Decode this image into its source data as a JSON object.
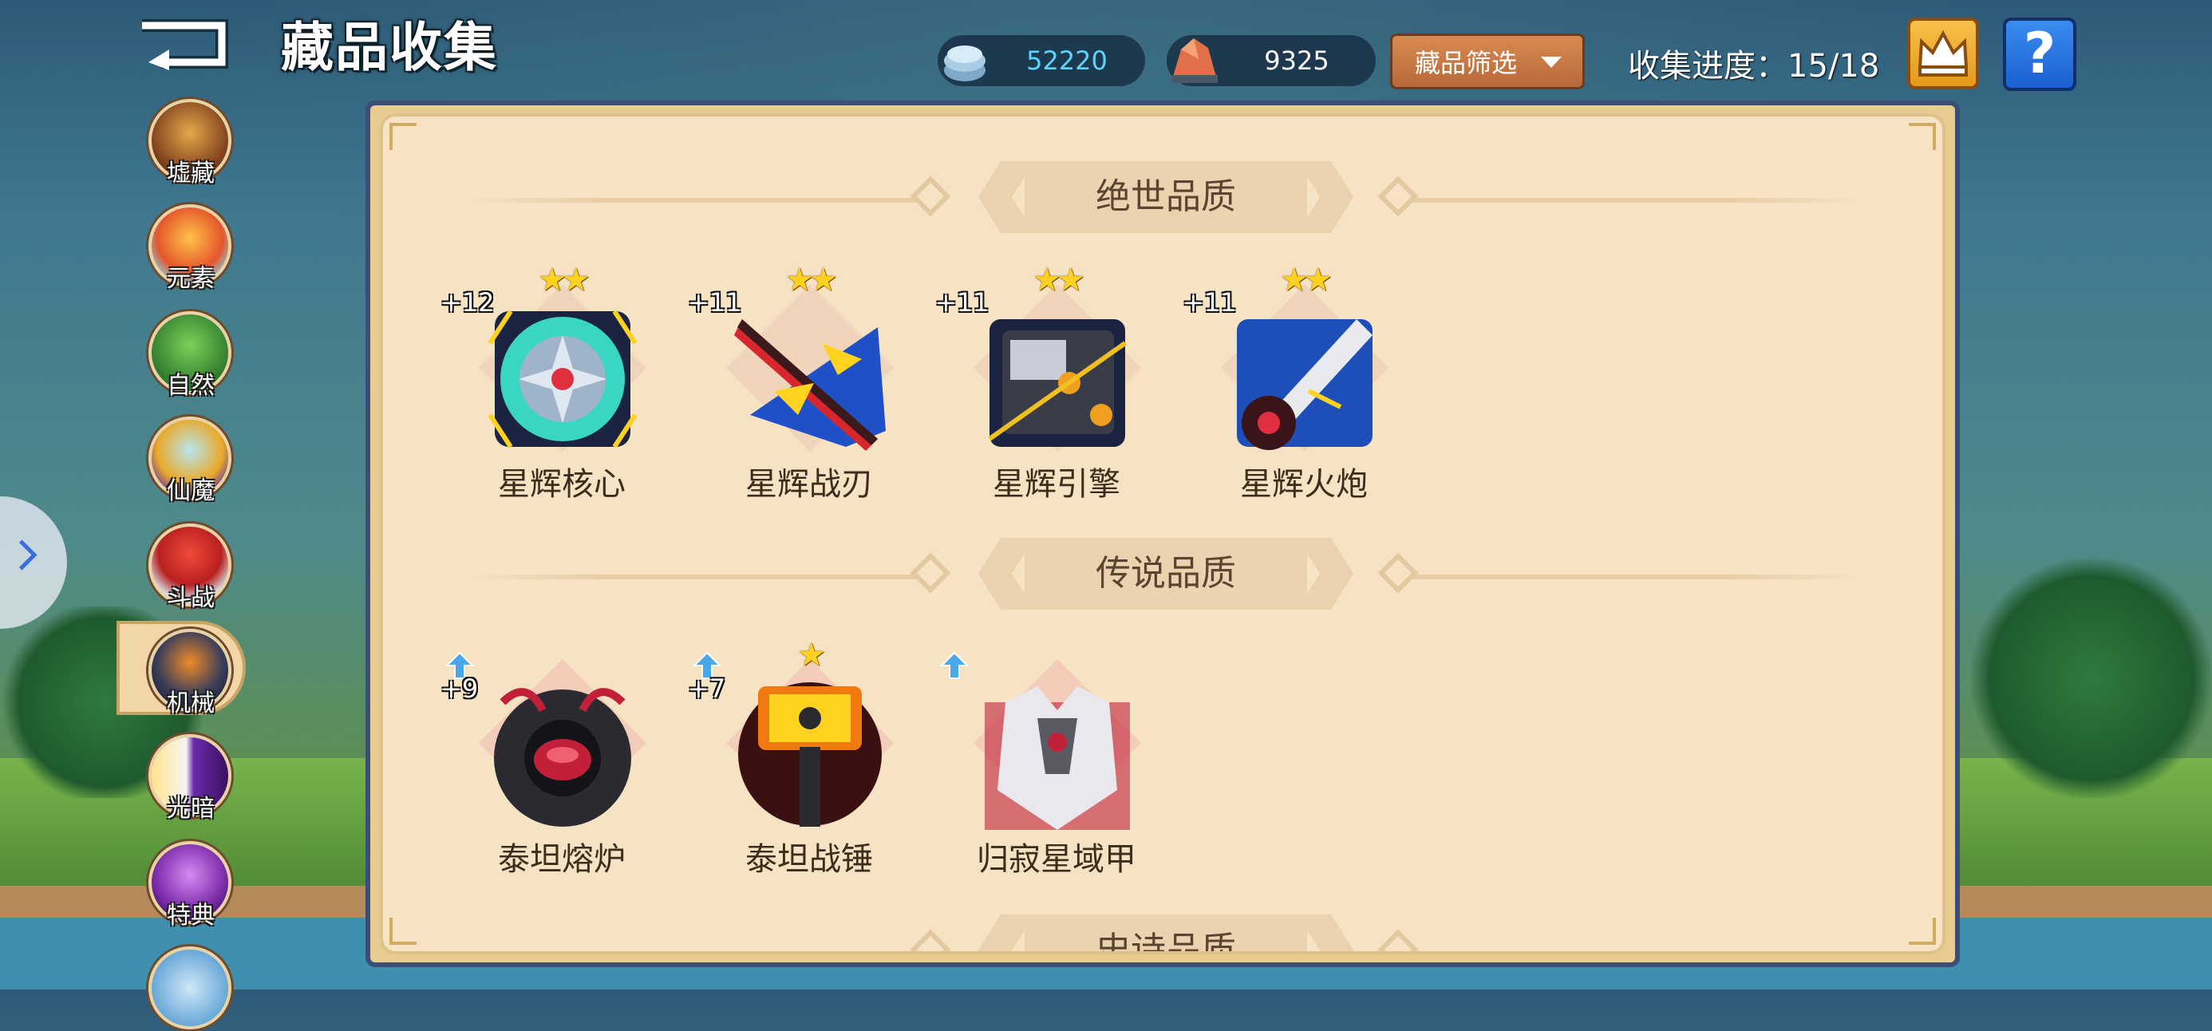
{
  "header": {
    "title": "藏品收集",
    "back_icon": "back-arrow-icon",
    "resources": [
      {
        "icon": "crystal-coin-icon",
        "value": "52220",
        "color": "#5fd3ff"
      },
      {
        "icon": "ore-icon",
        "value": "9325",
        "color": "#ffffff"
      }
    ],
    "filter_label": "藏品筛选",
    "progress_text": "收集进度：15/18",
    "crown_icon": "crown-icon",
    "help_label": "?"
  },
  "sidebar": {
    "items": [
      {
        "label": "墟藏",
        "icon": "ruins-jar-icon",
        "active": false
      },
      {
        "label": "元素",
        "icon": "element-flame-icon",
        "active": false
      },
      {
        "label": "自然",
        "icon": "nature-tree-icon",
        "active": false
      },
      {
        "label": "仙魔",
        "icon": "immortal-demon-icon",
        "active": false
      },
      {
        "label": "斗战",
        "icon": "battle-icon",
        "active": false
      },
      {
        "label": "机械",
        "icon": "mech-robot-icon",
        "active": true
      },
      {
        "label": "光暗",
        "icon": "light-dark-icon",
        "active": false
      },
      {
        "label": "特典",
        "icon": "special-star-icon",
        "active": false
      },
      {
        "label": "",
        "icon": "potion-icon",
        "active": false
      }
    ],
    "expand_icon": "chevron-right-icon"
  },
  "sections": [
    {
      "title": "绝世品质",
      "items": [
        {
          "name": "星辉核心",
          "level": "+12",
          "stars": "★★",
          "upgrade": false,
          "icon": "starlight-core-icon",
          "color": "#39d6c4"
        },
        {
          "name": "星辉战刃",
          "level": "+11",
          "stars": "★★",
          "upgrade": false,
          "icon": "starlight-blade-icon",
          "color": "#d8262e"
        },
        {
          "name": "星辉引擎",
          "level": "+11",
          "stars": "★★",
          "upgrade": false,
          "icon": "starlight-engine-icon",
          "color": "#f0c020"
        },
        {
          "name": "星辉火炮",
          "level": "+11",
          "stars": "★★",
          "upgrade": false,
          "icon": "starlight-cannon-icon",
          "color": "#1e4fb8"
        }
      ]
    },
    {
      "title": "传说品质",
      "items": [
        {
          "name": "泰坦熔炉",
          "level": "+9",
          "stars": "",
          "upgrade": true,
          "icon": "titan-furnace-icon",
          "color": "#c2203a"
        },
        {
          "name": "泰坦战锤",
          "level": "+7",
          "stars": "★",
          "upgrade": true,
          "icon": "titan-hammer-icon",
          "color": "#f07a10"
        },
        {
          "name": "归寂星域甲",
          "level": "",
          "stars": "",
          "upgrade": true,
          "icon": "star-domain-armor-icon",
          "color": "#e8e8ee"
        }
      ]
    },
    {
      "title": "史诗品质",
      "items": []
    }
  ]
}
